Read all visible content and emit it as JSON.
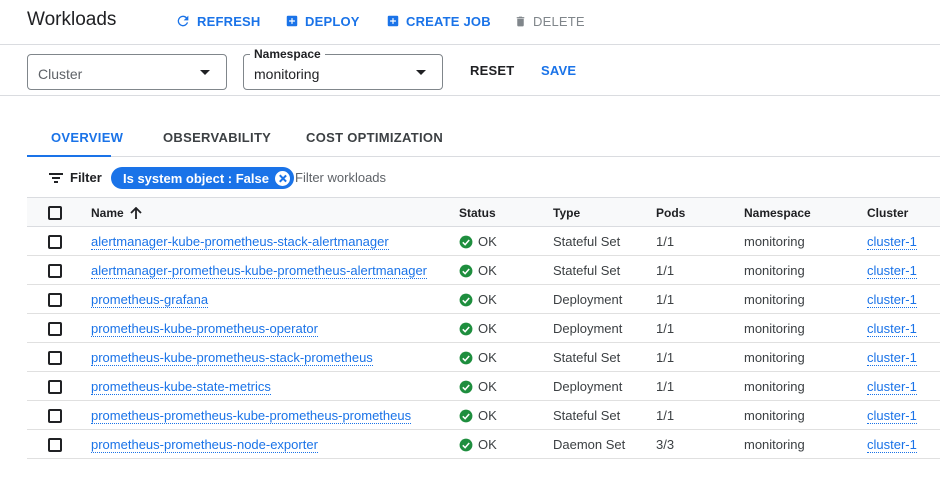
{
  "header": {
    "title": "Workloads",
    "refresh_label": "REFRESH",
    "deploy_label": "DEPLOY",
    "create_job_label": "CREATE JOB",
    "delete_label": "DELETE"
  },
  "filters": {
    "cluster_placeholder": "Cluster",
    "namespace_label": "Namespace",
    "namespace_value": "monitoring",
    "reset_label": "RESET",
    "save_label": "SAVE"
  },
  "tabs": [
    {
      "label": "OVERVIEW",
      "active": true
    },
    {
      "label": "OBSERVABILITY",
      "active": false
    },
    {
      "label": "COST OPTIMIZATION",
      "active": false
    }
  ],
  "filter_bar": {
    "filter_label": "Filter",
    "chip_label": "Is system object : False",
    "search_placeholder": "Filter workloads"
  },
  "table": {
    "columns": {
      "name": "Name",
      "status": "Status",
      "type": "Type",
      "pods": "Pods",
      "namespace": "Namespace",
      "cluster": "Cluster"
    },
    "rows": [
      {
        "name": "alertmanager-kube-prometheus-stack-alertmanager",
        "status": "OK",
        "type": "Stateful Set",
        "pods": "1/1",
        "namespace": "monitoring",
        "cluster": "cluster-1"
      },
      {
        "name": "alertmanager-prometheus-kube-prometheus-alertmanager",
        "status": "OK",
        "type": "Stateful Set",
        "pods": "1/1",
        "namespace": "monitoring",
        "cluster": "cluster-1"
      },
      {
        "name": "prometheus-grafana",
        "status": "OK",
        "type": "Deployment",
        "pods": "1/1",
        "namespace": "monitoring",
        "cluster": "cluster-1"
      },
      {
        "name": "prometheus-kube-prometheus-operator",
        "status": "OK",
        "type": "Deployment",
        "pods": "1/1",
        "namespace": "monitoring",
        "cluster": "cluster-1"
      },
      {
        "name": "prometheus-kube-prometheus-stack-prometheus",
        "status": "OK",
        "type": "Stateful Set",
        "pods": "1/1",
        "namespace": "monitoring",
        "cluster": "cluster-1"
      },
      {
        "name": "prometheus-kube-state-metrics",
        "status": "OK",
        "type": "Deployment",
        "pods": "1/1",
        "namespace": "monitoring",
        "cluster": "cluster-1"
      },
      {
        "name": "prometheus-prometheus-kube-prometheus-prometheus",
        "status": "OK",
        "type": "Stateful Set",
        "pods": "1/1",
        "namespace": "monitoring",
        "cluster": "cluster-1"
      },
      {
        "name": "prometheus-prometheus-node-exporter",
        "status": "OK",
        "type": "Daemon Set",
        "pods": "3/3",
        "namespace": "monitoring",
        "cluster": "cluster-1"
      }
    ]
  },
  "colors": {
    "accent": "#1a73e8",
    "ok_green": "#1e8e3e",
    "disabled": "#80868b"
  }
}
